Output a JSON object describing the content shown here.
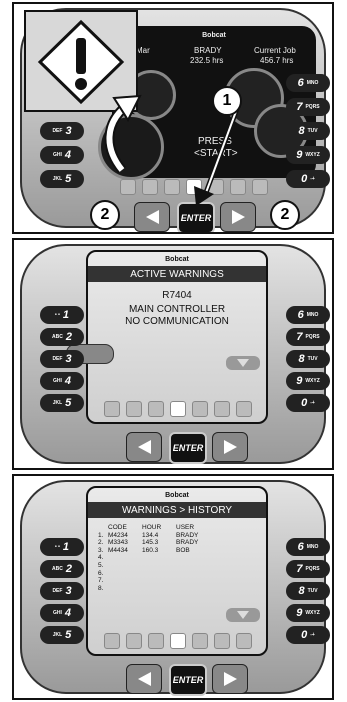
{
  "panel1": {
    "header": {
      "date": "Mar",
      "operator": "BRADY",
      "operator_hours": "232.5 hrs",
      "job_label": "Current Job",
      "job_hours": "456.7 hrs"
    },
    "logo": "Bobcat",
    "message_line1": "PRESS",
    "message_line2": "<START>",
    "callout_1": "1",
    "callout_2_left": "2",
    "callout_2_right": "2",
    "enter_label": "ENTER",
    "left_keys": [
      "3",
      "4",
      "5"
    ],
    "left_sub": [
      "DEF",
      "GHI",
      "JKL"
    ],
    "right_keys": [
      "6",
      "7",
      "8",
      "9",
      "0"
    ],
    "right_sub": [
      "MNO",
      "PQRS",
      "TUV",
      "WXYZ",
      "-+"
    ]
  },
  "panel2": {
    "logo": "Bobcat",
    "title": "ACTIVE WARNINGS",
    "code": "R7404",
    "line1": "MAIN CONTROLLER",
    "line2": "NO COMMUNICATION",
    "enter_label": "ENTER",
    "left_keys": [
      "1",
      "2",
      "3",
      "4",
      "5"
    ],
    "left_sub": [
      "• •",
      "ABC",
      "DEF",
      "GHI",
      "JKL"
    ],
    "right_keys": [
      "6",
      "7",
      "8",
      "9",
      "0"
    ],
    "right_sub": [
      "MNO",
      "PQRS",
      "TUV",
      "WXYZ",
      "-+"
    ]
  },
  "panel3": {
    "logo": "Bobcat",
    "title": "WARNINGS > HISTORY",
    "columns": [
      "CODE",
      "HOUR",
      "USER"
    ],
    "rows": [
      {
        "num": "1.",
        "code": "M4234",
        "hour": "134.4",
        "user": "BRADY"
      },
      {
        "num": "2.",
        "code": "M3343",
        "hour": "145.3",
        "user": "BRADY"
      },
      {
        "num": "3.",
        "code": "M4434",
        "hour": "160.3",
        "user": "BOB"
      },
      {
        "num": "4.",
        "code": "",
        "hour": "",
        "user": ""
      },
      {
        "num": "5.",
        "code": "",
        "hour": "",
        "user": ""
      },
      {
        "num": "6.",
        "code": "",
        "hour": "",
        "user": ""
      },
      {
        "num": "7.",
        "code": "",
        "hour": "",
        "user": ""
      },
      {
        "num": "8.",
        "code": "",
        "hour": "",
        "user": ""
      }
    ],
    "enter_label": "ENTER",
    "left_keys": [
      "1",
      "2",
      "3",
      "4",
      "5"
    ],
    "left_sub": [
      "• •",
      "ABC",
      "DEF",
      "GHI",
      "JKL"
    ],
    "right_keys": [
      "6",
      "7",
      "8",
      "9",
      "0"
    ],
    "right_sub": [
      "MNO",
      "PQRS",
      "TUV",
      "WXYZ",
      "-+"
    ]
  },
  "colors": {
    "bezel": "#b5b5b5",
    "key": "#222222",
    "screen_dark": "#111111"
  },
  "icons": [
    "warning-icon",
    "arrow-left-icon",
    "arrow-right-icon",
    "curved-arrow-icon"
  ]
}
